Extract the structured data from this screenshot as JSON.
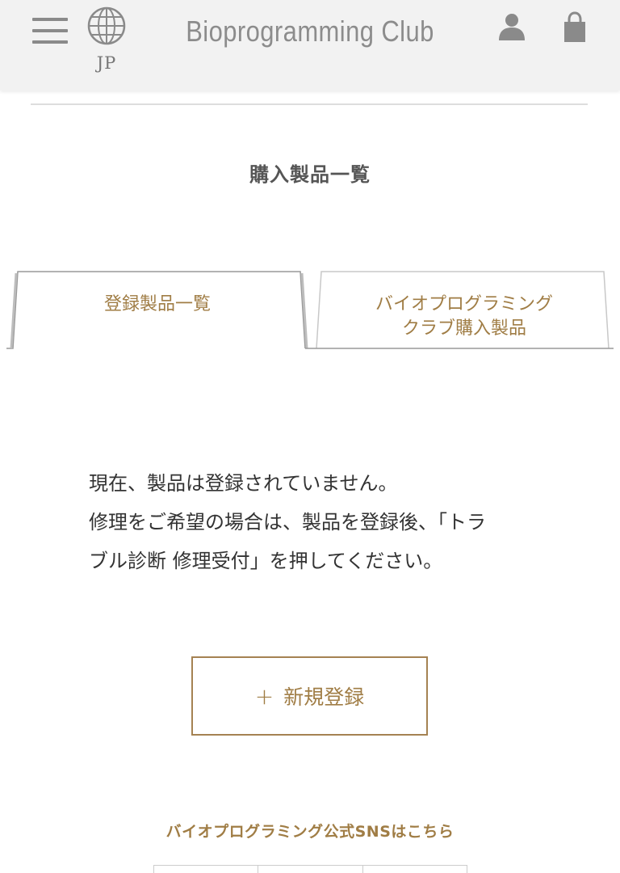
{
  "header": {
    "brand": "Bioprogramming Club",
    "language": "JP",
    "icons": [
      "menu-icon",
      "globe-icon",
      "user-icon",
      "shopping-bag-icon"
    ]
  },
  "page": {
    "title": "購入製品一覧"
  },
  "tabs": [
    {
      "label_line1": "登録製品一覧",
      "label_line2": "",
      "active": true
    },
    {
      "label_line1": "バイオプログラミング",
      "label_line2": "クラブ購入製品",
      "active": false
    }
  ],
  "message": {
    "line1": "現在、製品は登録されていません。",
    "line2": "修理をご希望の場合は、製品を登録後、「トラ",
    "line3": "ブル診断 修理受付」を押してください。"
  },
  "actions": {
    "new_register_plus": "+",
    "new_register_label": "新規登録"
  },
  "footer": {
    "sns_link": "バイオプログラミング公式SNSはこちら"
  },
  "colors": {
    "accent": "#a07d45",
    "header_bg": "#f2f2f2",
    "icon_gray": "#8a8a8a"
  }
}
